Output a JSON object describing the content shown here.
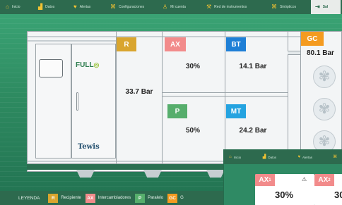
{
  "nav": {
    "items": [
      {
        "label": "Inicio",
        "icon": "home-icon"
      },
      {
        "label": "Datos",
        "icon": "bar-chart-icon"
      },
      {
        "label": "Alertas",
        "icon": "bell-alert-icon"
      },
      {
        "label": "Configuraciones",
        "icon": "settings-icon"
      },
      {
        "label": "Mi cuenta",
        "icon": "user-icon"
      },
      {
        "label": "Red de instrumentos",
        "icon": "wrench-icon"
      },
      {
        "label": "Sinópticos",
        "icon": "synoptic-icon"
      },
      {
        "label": "Sal",
        "icon": "logout-icon"
      }
    ]
  },
  "cabinet": {
    "brand_full": "FULL",
    "brand_tewis": "Tewis"
  },
  "sections": {
    "R": {
      "tag": "R",
      "value": "33.7 Bar",
      "color": "#d9a52e"
    },
    "AX": {
      "tag": "AX",
      "value": "30%",
      "color": "#f28b8b"
    },
    "BT": {
      "tag": "BT",
      "value": "14.1 Bar",
      "color": "#1e7fd6"
    },
    "P": {
      "tag": "P",
      "value": "50%",
      "color": "#56ae6c"
    },
    "MT": {
      "tag": "MT",
      "value": "24.2 Bar",
      "color": "#24a3e0"
    },
    "GC": {
      "tag": "GC",
      "value": "80.1 Bar",
      "color": "#f49b20"
    }
  },
  "mini_window": {
    "nav": [
      {
        "label": "Inicio"
      },
      {
        "label": "Datos"
      },
      {
        "label": "Alertas"
      }
    ],
    "cards": [
      {
        "tag": "AX",
        "sub": "1",
        "value": "30%",
        "warning_icon": "warning-icon"
      },
      {
        "tag": "AX",
        "sub": "2",
        "value": "30"
      }
    ]
  },
  "legend": {
    "title": "LEYENDA",
    "items": [
      {
        "tag": "R",
        "label": "Recipiente",
        "color": "#d9a52e"
      },
      {
        "tag": "AX",
        "label": "Intercambiadores",
        "color": "#f28b8b"
      },
      {
        "tag": "P",
        "label": "Paralelo",
        "color": "#56ae6c"
      },
      {
        "tag": "GC",
        "label": "G",
        "color": "#f49b20"
      }
    ]
  }
}
